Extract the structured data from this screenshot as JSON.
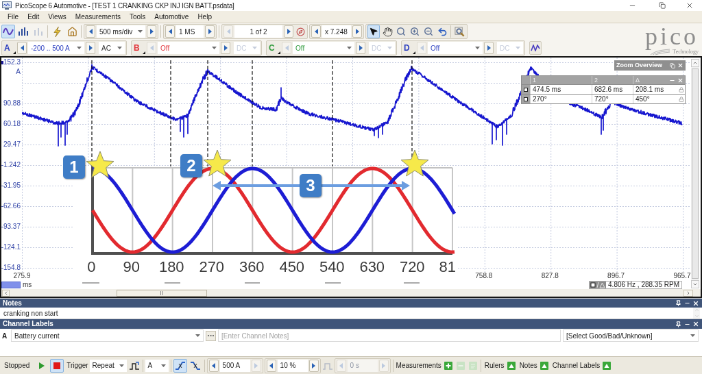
{
  "window": {
    "title": "PicoScope 6 Automotive - [TEST 1 CRANKING CKP INJ IGN BATT.psdata]"
  },
  "menu": [
    "File",
    "Edit",
    "Views",
    "Measurements",
    "Tools",
    "Automotive",
    "Help"
  ],
  "toolbar": {
    "views": [
      {
        "kind": "scope",
        "selected": true,
        "disabled": false
      },
      {
        "kind": "spectrum",
        "selected": false,
        "disabled": false
      },
      {
        "kind": "persistence",
        "selected": false,
        "disabled": true
      }
    ],
    "timebase": {
      "value": "500 ms/div",
      "prev_disabled": false,
      "next_disabled": false
    },
    "samples": {
      "value": "1 MS",
      "prev_disabled": false,
      "next_disabled": false
    },
    "buffer": {
      "value": "1 of 2",
      "prev_disabled": true,
      "next_disabled": false
    },
    "zoom": {
      "value": "x 7.248",
      "prev_disabled": false,
      "next_disabled": false
    },
    "tools": [
      {
        "kind": "pointer",
        "selected": true
      },
      {
        "kind": "hand",
        "selected": false
      },
      {
        "kind": "zoom",
        "selected": false
      },
      {
        "kind": "zoom_in",
        "selected": false
      },
      {
        "kind": "zoom_out",
        "selected": false
      },
      {
        "kind": "undo",
        "selected": false
      },
      {
        "kind": "zoom_fit",
        "selected": false
      }
    ]
  },
  "channels": [
    {
      "name": "A",
      "color": "#2c3fc0",
      "range": "-200 .. 500 A",
      "coupling": "AC",
      "enabled": true
    },
    {
      "name": "B",
      "color": "#e2363c",
      "range": "Off",
      "coupling": "DC",
      "enabled": false
    },
    {
      "name": "C",
      "color": "#2f9a3c",
      "range": "Off",
      "coupling": "DC",
      "enabled": false
    },
    {
      "name": "D",
      "color": "#2c3fc0",
      "range": "Off",
      "coupling": "DC",
      "enabled": false
    }
  ],
  "logo": {
    "name": "pico",
    "tagline": "Technology"
  },
  "scope": {
    "y_axis": {
      "unit": "A",
      "labels": [
        "152.3",
        "90.88",
        "60.18",
        "29.47",
        "-1.242",
        "-31.95",
        "-62.66",
        "-93.37",
        "-124.1",
        "-154.8"
      ]
    },
    "x_axis": {
      "start": "275.9",
      "labels": [
        "758.8",
        "827.8",
        "896.7",
        "965.7"
      ],
      "unit": "ms"
    },
    "diagram": {
      "callouts": [
        "1",
        "2",
        "3"
      ],
      "degree_labels": [
        "0",
        "90",
        "180",
        "270",
        "360",
        "450",
        "540",
        "630",
        "720",
        "81"
      ]
    },
    "zoom_overview": {
      "title": "Zoom Overview"
    },
    "rulers_table": {
      "columns": [
        "1",
        "2",
        "Δ"
      ],
      "rows": [
        [
          "474.5 ms",
          "682.6 ms",
          "208.1 ms"
        ],
        [
          "270°",
          "720°",
          "450°"
        ]
      ]
    },
    "frequency": "4.806 Hz , 288.35 RPM"
  },
  "notes": {
    "title": "Notes",
    "text": "cranking non start"
  },
  "channel_labels": {
    "title": "Channel Labels",
    "rows": [
      {
        "channel": "A",
        "label": "Battery current",
        "notes_field": {
          "placeholder": "[Enter Channel Notes]"
        },
        "status": "[Select Good/Bad/Unknown]"
      }
    ]
  },
  "status_bar": {
    "state": "Stopped",
    "run_controls": [
      {
        "kind": "start",
        "selected": false
      },
      {
        "kind": "stop",
        "selected": true
      }
    ],
    "trigger_label": "Trigger",
    "trigger_mode": "Repeat",
    "trigger_source": "A",
    "edges": [
      {
        "kind": "rising",
        "selected": true
      },
      {
        "kind": "falling",
        "selected": false
      }
    ],
    "threshold": {
      "value": "500 A",
      "prev_disabled": false,
      "next_disabled": true
    },
    "pre_trigger": {
      "value": "10 %",
      "prev_disabled": false,
      "next_disabled": false
    },
    "delay": {
      "value": "0 s",
      "disabled": true
    },
    "measurements": {
      "label": "Measurements",
      "buttons": [
        {
          "kind": "add",
          "disabled": false
        },
        {
          "kind": "delete",
          "disabled": true
        },
        {
          "kind": "edit",
          "disabled": true
        }
      ]
    },
    "panels": [
      {
        "label": "Rulers"
      },
      {
        "label": "Notes"
      },
      {
        "label": "Channel Labels"
      }
    ]
  }
}
